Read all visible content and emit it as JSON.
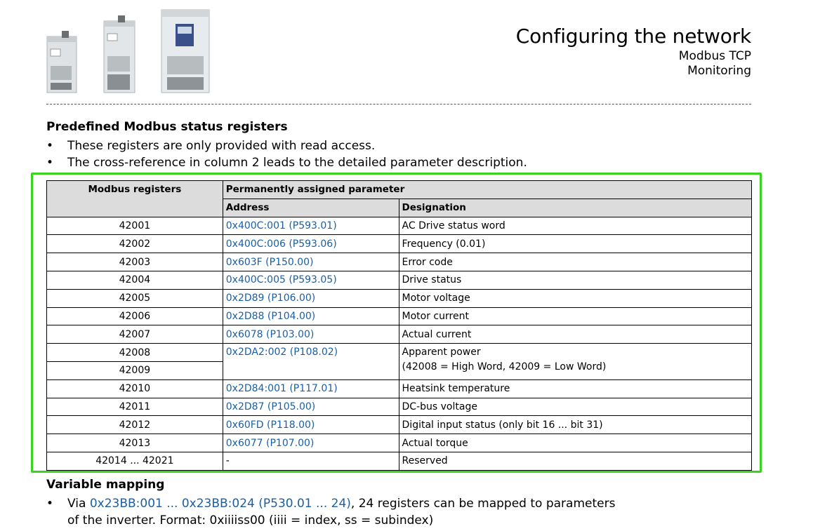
{
  "header": {
    "title": "Configuring the network",
    "subtitle_1": "Modbus TCP",
    "subtitle_2": "Monitoring"
  },
  "section1": {
    "heading": "Predefined Modbus status registers",
    "bullets": [
      "These registers are only provided with read access.",
      "The cross-reference in column 2 leads to the detailed parameter description."
    ]
  },
  "table": {
    "col1_header": "Modbus registers",
    "group_header": "Permanently assigned parameter",
    "col2_header": "Address",
    "col3_header": "Designation",
    "rows": [
      {
        "register": "42001",
        "address": "0x400C:001 (P593.01)",
        "designation": "AC Drive status word"
      },
      {
        "register": "42002",
        "address": "0x400C:006 (P593.06)",
        "designation": "Frequency (0.01)"
      },
      {
        "register": "42003",
        "address": "0x603F (P150.00)",
        "designation": "Error code"
      },
      {
        "register": "42004",
        "address": "0x400C:005 (P593.05)",
        "designation": "Drive status"
      },
      {
        "register": "42005",
        "address": "0x2D89 (P106.00)",
        "designation": "Motor voltage"
      },
      {
        "register": "42006",
        "address": "0x2D88 (P104.00)",
        "designation": "Motor current"
      },
      {
        "register": "42007",
        "address": "0x6078 (P103.00)",
        "designation": "Actual current"
      },
      {
        "register": "42008",
        "address": "0x2DA2:002 (P108.02)",
        "designation": "Apparent power",
        "designation_2": "(42008 = High Word, 42009 = Low Word)"
      },
      {
        "register": "42009"
      },
      {
        "register": "42010",
        "address": "0x2D84:001 (P117.01)",
        "designation": "Heatsink temperature"
      },
      {
        "register": "42011",
        "address": "0x2D87 (P105.00)",
        "designation": "DC-bus voltage"
      },
      {
        "register": "42012",
        "address": "0x60FD (P118.00)",
        "designation": "Digital input status (only bit 16 ... bit 31)"
      },
      {
        "register": "42013",
        "address": "0x6077 (P107.00)",
        "designation": "Actual torque"
      },
      {
        "register": "42014 ... 42021",
        "address": "-",
        "designation": "Reserved"
      }
    ]
  },
  "section2": {
    "heading": "Variable mapping",
    "bullet_prefix": "Via ",
    "bullet_link": "0x23BB:001 ... 0x23BB:024 (P530.01 ... 24)",
    "bullet_suffix": ", 24 registers can be mapped to parameters",
    "bullet_line2": "of the inverter. Format: 0xiiiiss00 (iiii = index, ss = subindex)"
  }
}
